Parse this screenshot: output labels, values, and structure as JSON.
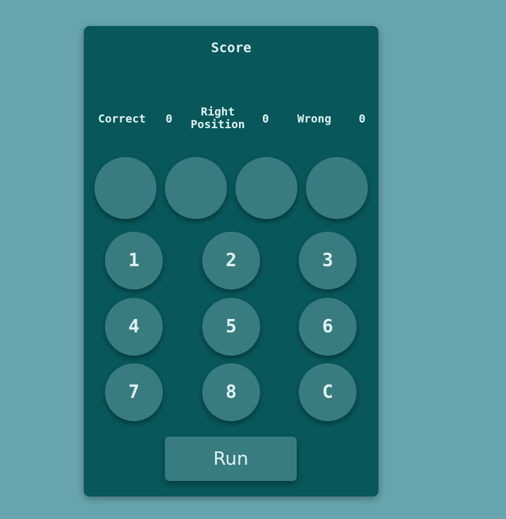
{
  "score": {
    "title": "Score",
    "correct_label": "Correct",
    "correct_value": "0",
    "right_position_label_line1": "Right",
    "right_position_label_line2": "Position",
    "right_position_value": "0",
    "wrong_label": "Wrong",
    "wrong_value": "0"
  },
  "keypad": {
    "keys": [
      "1",
      "2",
      "3",
      "4",
      "5",
      "6",
      "7",
      "8",
      "C"
    ]
  },
  "run_label": "Run",
  "colors": {
    "background": "#67a4ad",
    "panel": "#08575a",
    "button": "#397c80",
    "text": "#dff2f2"
  }
}
